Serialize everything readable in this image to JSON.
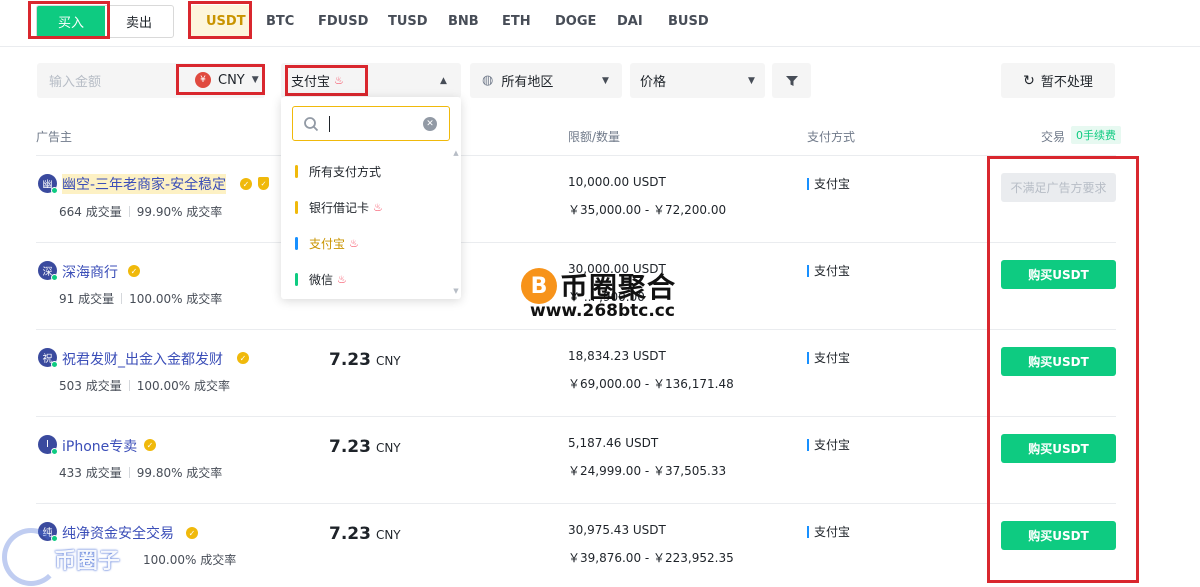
{
  "side": {
    "buy": "买入",
    "sell": "卖出"
  },
  "assets": [
    "USDT",
    "BTC",
    "FDUSD",
    "TUSD",
    "BNB",
    "ETH",
    "DOGE",
    "DAI",
    "BUSD"
  ],
  "filters": {
    "amount_placeholder": "输入金额",
    "currency": "CNY",
    "currency_symbol": "¥",
    "payment": "支付宝",
    "region": "所有地区",
    "sort": "价格",
    "refresh": "暂不处理"
  },
  "dropdown": {
    "search_value": "",
    "items": [
      {
        "label": "所有支付方式",
        "color": "#f0b90b",
        "hot": false
      },
      {
        "label": "银行借记卡",
        "color": "#f0b90b",
        "hot": true
      },
      {
        "label": "支付宝",
        "color": "#1890ff",
        "hot": true,
        "selected": true
      },
      {
        "label": "微信",
        "color": "#0ecb81",
        "hot": true
      }
    ]
  },
  "table": {
    "headers": {
      "advertiser": "广告主",
      "limit": "限额/数量",
      "payment": "支付方式",
      "trade": "交易",
      "fee": "0手续费"
    },
    "rows": [
      {
        "avatar": "幽",
        "name": "幽空-三年老商家-安全稳定",
        "orders": "664 成交量",
        "rate": "99.90% 成交率",
        "price": "",
        "currency": "",
        "amount": "10,000.00 USDT",
        "range": "￥35,000.00 - ￥72,200.00",
        "payment": "支付宝",
        "action": "不满足广告方要求",
        "enabled": false
      },
      {
        "avatar": "深",
        "name": "深海商行",
        "orders": "91 成交量",
        "rate": "100.00% 成交率",
        "price": "",
        "currency": "",
        "amount": "30,000.00 USDT",
        "range": "￥ ... ,900.00",
        "payment": "支付宝",
        "action": "购买USDT",
        "enabled": true
      },
      {
        "avatar": "祝",
        "name": "祝君发财_出金入金都发财",
        "orders": "503 成交量",
        "rate": "100.00% 成交率",
        "price": "7.23",
        "currency": "CNY",
        "amount": "18,834.23 USDT",
        "range": "￥69,000.00 - ￥136,171.48",
        "payment": "支付宝",
        "action": "购买USDT",
        "enabled": true
      },
      {
        "avatar": "I",
        "name": "iPhone专卖",
        "orders": "433 成交量",
        "rate": "99.80% 成交率",
        "price": "7.23",
        "currency": "CNY",
        "amount": "5,187.46 USDT",
        "range": "￥24,999.00 - ￥37,505.33",
        "payment": "支付宝",
        "action": "购买USDT",
        "enabled": true
      },
      {
        "avatar": "纯",
        "name": "纯净资金安全交易",
        "orders": "",
        "rate": "100.00% 成交率",
        "price": "7.23",
        "currency": "CNY",
        "amount": "30,975.43 USDT",
        "range": "￥39,876.00 - ￥223,952.35",
        "payment": "支付宝",
        "action": "购买USDT",
        "enabled": true
      }
    ]
  },
  "watermark": {
    "title": "币圈聚合",
    "url": "www.268btc.cc",
    "coin": "B",
    "bottom": "币圈子"
  }
}
